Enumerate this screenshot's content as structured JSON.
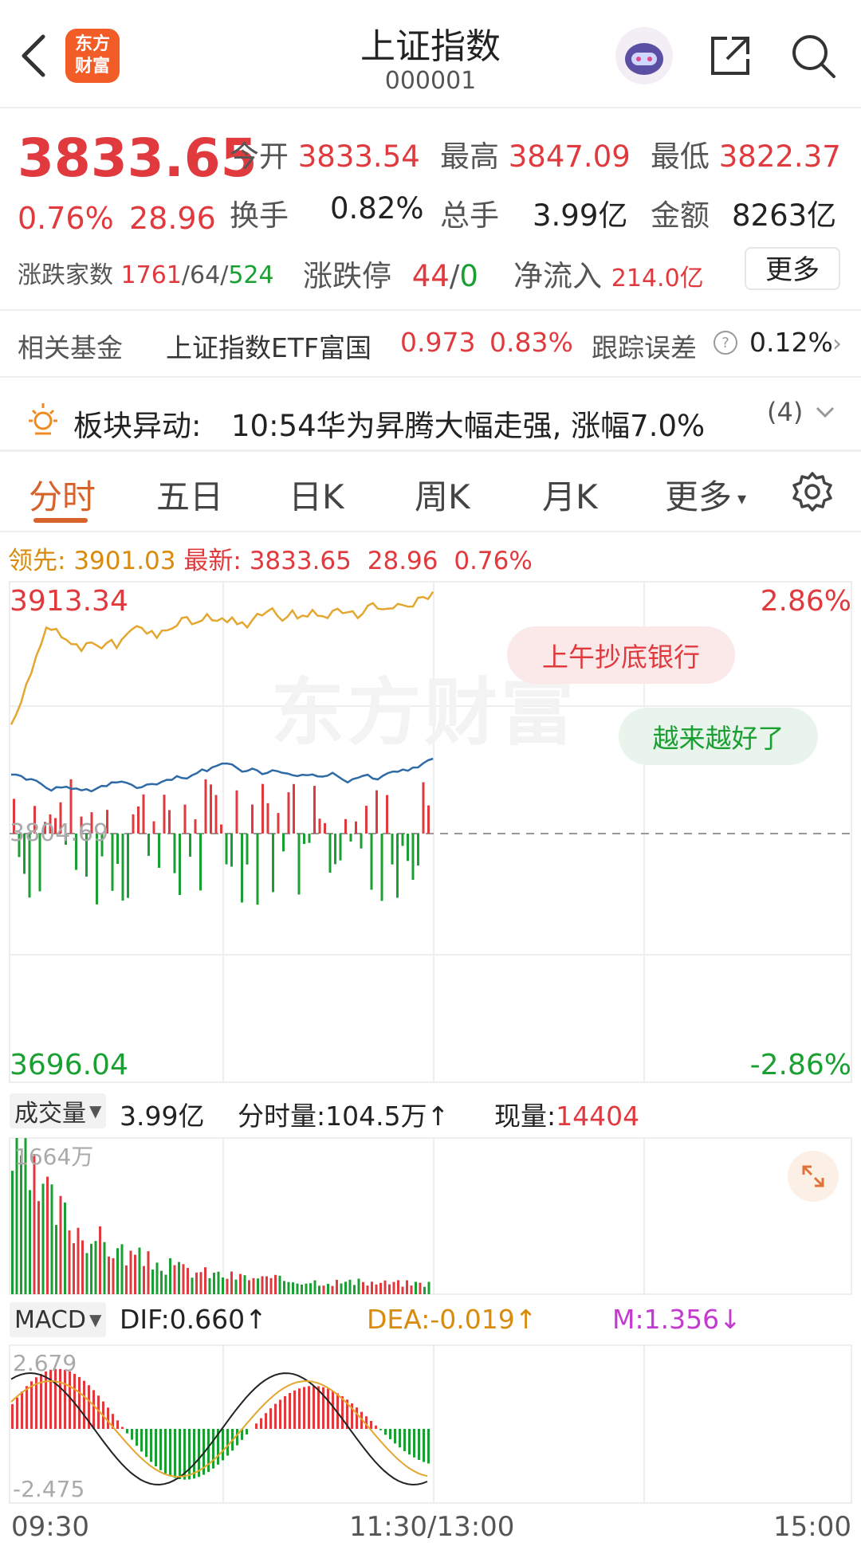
{
  "header": {
    "logo_line1": "东方",
    "logo_line2": "财富",
    "title": "上证指数",
    "code": "000001"
  },
  "quote": {
    "price": "3833.65",
    "pct": "0.76%",
    "change": "28.96",
    "open_label": "今开",
    "open": "3833.54",
    "high_label": "最高",
    "high": "3847.09",
    "low_label": "最低",
    "low": "3822.37",
    "turnover_label": "换手",
    "turnover": "0.82%",
    "volume_label": "总手",
    "volume": "3.99亿",
    "amount_label": "金额",
    "amount": "8263亿",
    "breadth_label": "涨跌家数",
    "up": "1761",
    "flat": "64",
    "down": "524",
    "limit_label": "涨跌停",
    "limit_up": "44",
    "limit_sep": "/",
    "limit_down": "0",
    "netflow_label": "净流入",
    "netflow": "214.0亿",
    "more": "更多"
  },
  "fund": {
    "label": "相关基金",
    "name": "上证指数ETF富国",
    "price": "0.973",
    "pct": "0.83%",
    "track_label": "跟踪误差",
    "track": "0.12%"
  },
  "alert": {
    "label": "板块异动:",
    "text": "10:54华为昇腾大幅走强, 涨幅7.0%",
    "count": "(4)"
  },
  "tabs": [
    "分时",
    "五日",
    "日K",
    "周K",
    "月K",
    "更多"
  ],
  "lead": {
    "lead_label": "领先:",
    "lead": "3901.03",
    "latest_label": "最新:",
    "latest": "3833.65",
    "change": "28.96",
    "pct": "0.76%"
  },
  "chart": {
    "ymax": "3913.34",
    "ymin": "3696.04",
    "prev_close": "3804.69",
    "pmax": "2.86%",
    "pmin": "-2.86%",
    "watermark": "东方财富",
    "bubble1": "上午抄底银行",
    "bubble2": "越来越好了"
  },
  "volbar": {
    "label": "成交量",
    "total": "3.99亿",
    "fs_label": "分时量:",
    "fs": "104.5万↑",
    "now_label": "现量:",
    "now": "14404",
    "max": "1664万"
  },
  "macd": {
    "label": "MACD",
    "dif": "DIF:0.660↑",
    "dea": "DEA:-0.019↑",
    "m": "M:1.356↓",
    "max": "2.679",
    "min": "-2.475"
  },
  "time": {
    "t1": "09:30",
    "t2": "11:30/13:00",
    "t3": "15:00"
  },
  "colors": {
    "up": "#e03a3e",
    "down": "#1aa032",
    "accent": "#d7632a",
    "price_line": "#e3a72f",
    "avg_line": "#2e6ba6"
  },
  "icons": [
    "back-icon",
    "share-icon",
    "search-icon",
    "robot-icon",
    "sun-icon",
    "help-icon",
    "settings-icon",
    "expand-icon"
  ]
}
